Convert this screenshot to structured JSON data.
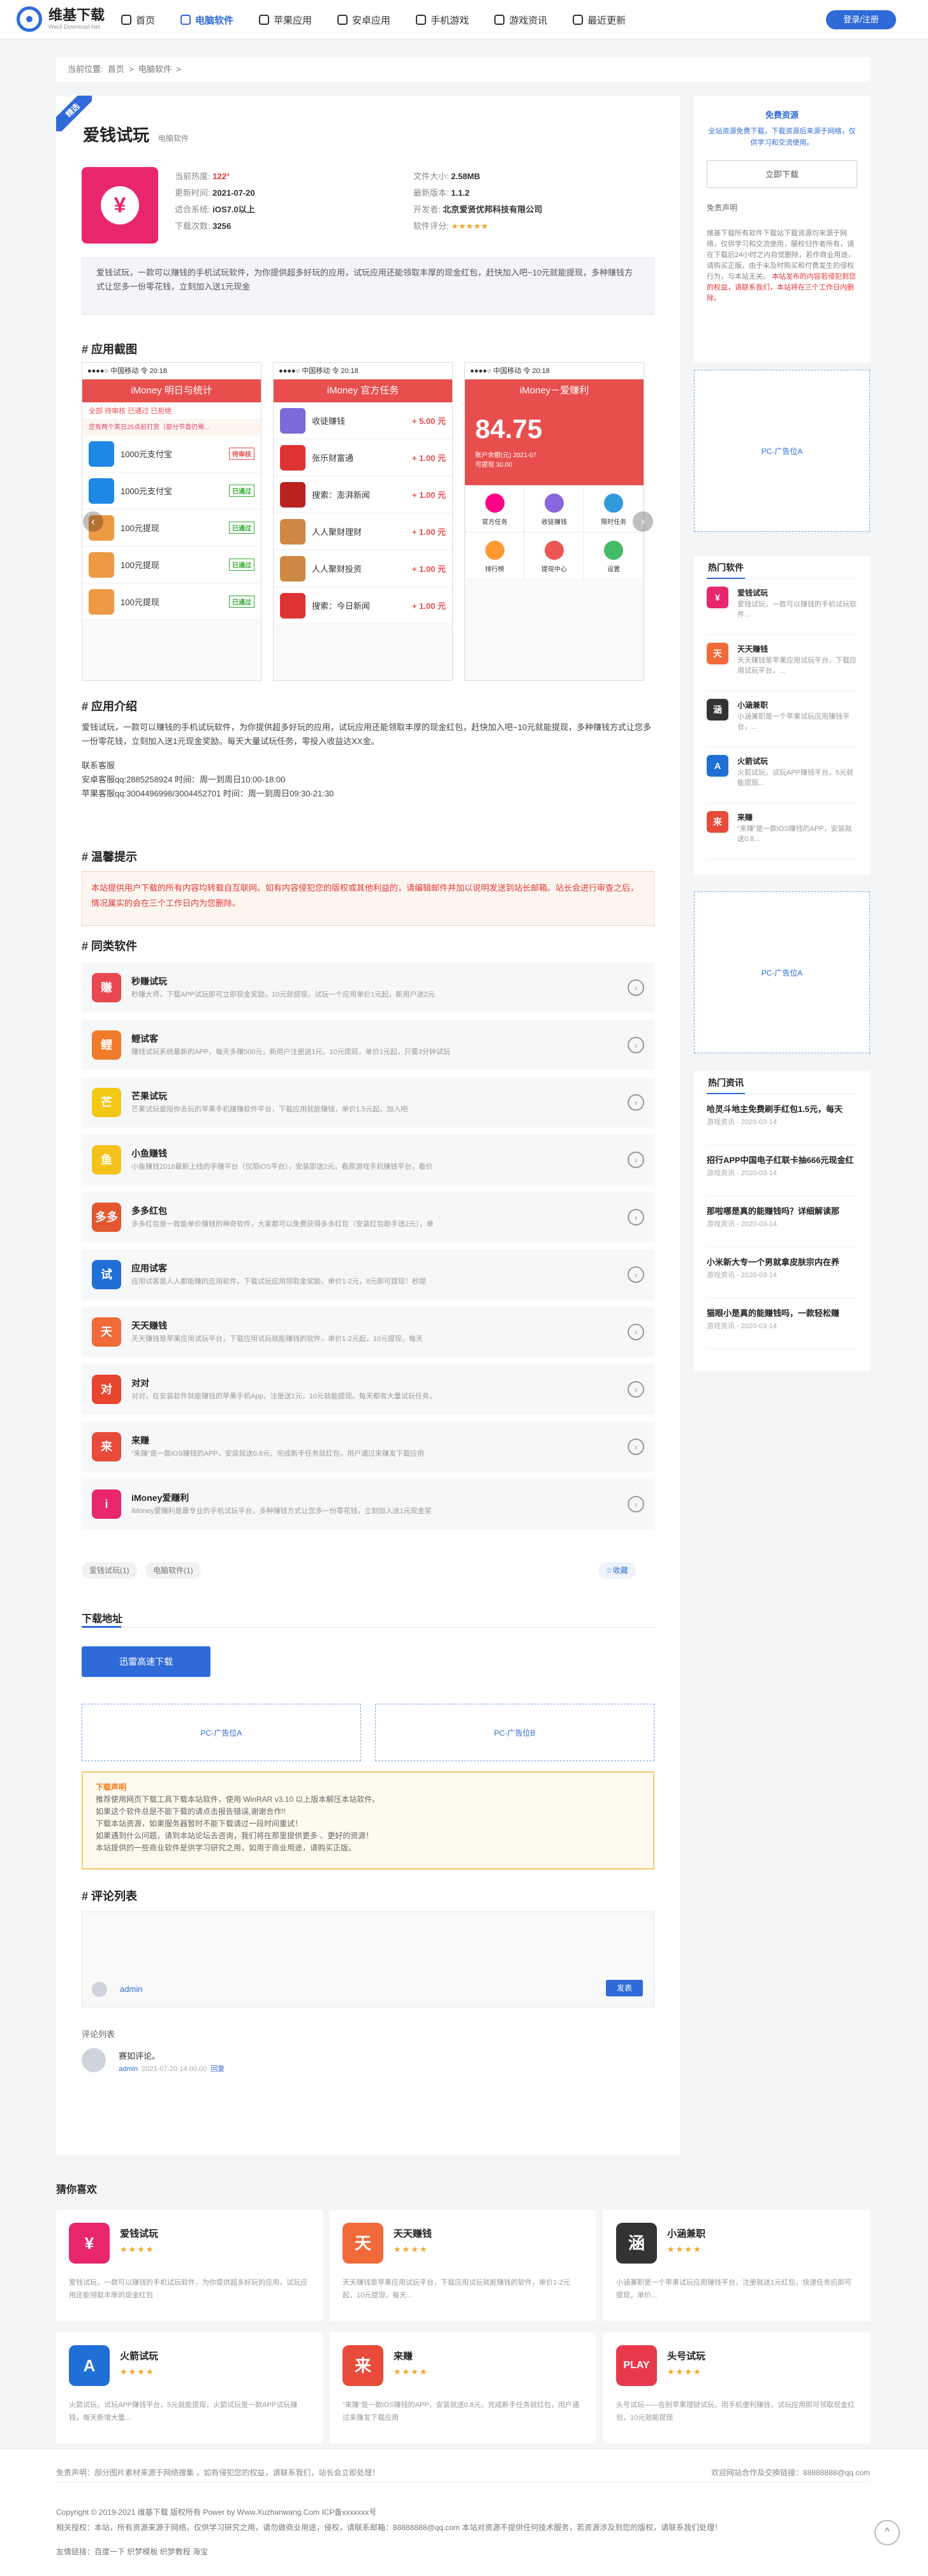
{
  "header": {
    "logo_title": "维基下载",
    "logo_sub": "WeiJi Download Net",
    "nav": [
      "首页",
      "电脑软件",
      "苹果应用",
      "安卓应用",
      "手机游戏",
      "游戏资讯",
      "最近更新"
    ],
    "login": "登录/注册"
  },
  "breadcrumb": {
    "label": "当前位置:",
    "home": "首页",
    "sep1": ">",
    "cat": "电脑软件",
    "sep2": ">"
  },
  "app": {
    "badge": "精选",
    "name": "爱钱试玩",
    "category": "电脑软件",
    "meta_left": [
      {
        "k": "当前热度:",
        "v": "122°"
      },
      {
        "k": "更新时间:",
        "v": "2021-07-20"
      },
      {
        "k": "适合系统:",
        "v": "iOS7.0以上"
      },
      {
        "k": "下载次数:",
        "v": "3256"
      }
    ],
    "meta_right": [
      {
        "k": "文件大小:",
        "v": "2.58MB"
      },
      {
        "k": "最新版本:",
        "v": "1.1.2"
      },
      {
        "k": "开发者:",
        "v": "北京爱贤优邦科技有限公司"
      },
      {
        "k": "软件评分:",
        "v": "★★★★★"
      }
    ],
    "description": "爱钱试玩，一款可以赚钱的手机试玩软件，为你提供超多好玩的应用，试玩应用还能领取丰厚的现金红包，赶快加入吧~10元就能提现，多种赚钱方式让您多一份零花钱，立刻加入送1元现金"
  },
  "screenshots": {
    "title": "应用截图",
    "shots": [
      {
        "status": "●●●●○ 中国移动 令   20:18",
        "header": "iMoney   明日与统计",
        "tabs": "全部  待审核  已通过  已拒绝",
        "note": "您有两个笑日25点前打赏（部分节首仍需...",
        "rows": [
          {
            "name": "1000元支付宝",
            "amt": "待审核"
          },
          {
            "name": "1000元支付宝",
            "amt": "已通过"
          },
          {
            "name": "100元提现",
            "amt": "已通过"
          },
          {
            "name": "100元提现",
            "amt": "已通过"
          },
          {
            "name": "100元提现",
            "amt": "已通过"
          }
        ]
      },
      {
        "status": "●●●●○ 中国移动 令   20:18",
        "header": "iMoney    官方任务",
        "rows": [
          {
            "name": "收徒赚钱",
            "amt": "+ 5.00 元"
          },
          {
            "name": "张乐财富通",
            "amt": "+ 1.00 元"
          },
          {
            "name": "搜索：澎湃新闻",
            "amt": "+ 1.00 元"
          },
          {
            "name": "人人聚财理财",
            "amt": "+ 1.00 元"
          },
          {
            "name": "人人聚财投资",
            "amt": "+ 1.00 元"
          },
          {
            "name": "搜索：今日新闻",
            "amt": "+ 1.00 元"
          }
        ]
      },
      {
        "status": "●●●●○ 中国移动 令   20:18",
        "header": "iMoney－爱赚利",
        "balance": "84.75",
        "sub1": "账户余额(元)   2021-07",
        "sub2": "可提现 30.00",
        "grid": [
          "官方任务",
          "收徒赚钱",
          "限时任务",
          "排行榜",
          "提现中心",
          "设置"
        ]
      }
    ]
  },
  "intro": {
    "title": "应用介绍",
    "p1": "爱钱试玩，一款可以赚钱的手机试玩软件，为你提供超多好玩的应用，试玩应用还能领取丰厚的现金红包，赶快加入吧~10元就能提现，多种赚钱方式让您多一份零花钱，立刻加入送1元现金奖励。每天大量试玩任务，零投入收益达XX金。",
    "contact_h": "联系客服",
    "c1": "安卓客服qq:2885258924 时间：周一到周日10:00-18:00",
    "c2": "苹果客服qq:3004496998/3004452701 时间：周一到周日09:30-21:30"
  },
  "warning": {
    "title": "温馨提示",
    "text": "本站提供用户下载的所有内容均转载自互联网。如有内容侵犯您的版权或其他利益的，请编辑邮件并加以说明发送到站长邮箱。站长会进行审查之后，情况属实的会在三个工作日内为您删除。"
  },
  "similar": {
    "title": "同类软件",
    "items": [
      {
        "name": "秒赚试玩",
        "desc": "秒赚大师，下载APP试玩即可立即现金奖励，10元就提现，试玩一个应用单价1元起，新用户送2元",
        "ic": "#e9474f",
        "t": "賺"
      },
      {
        "name": "鲤试客",
        "desc": "赚钱试玩系统最新的APP，每天多赚500元，新用户注册送1元，10元提现，单价1元起，只要3分钟试玩",
        "ic": "#f07b2b",
        "t": "鲤"
      },
      {
        "name": "芒果试玩",
        "desc": "芒果试玩是陪你去玩的苹果手机赚赚软件平台，下载应用就能赚钱，单价1.5元起，加入吧",
        "ic": "#f3c716",
        "t": "芒"
      },
      {
        "name": "小鱼赚钱",
        "desc": "小鱼赚钱2016最新上线的手赚平台（仅限iOS平台），安装即送2元，看原游戏手机赚钱平台，看价",
        "ic": "#f5c21c",
        "t": "鱼"
      },
      {
        "name": "多多红包",
        "desc": "多多红包是一款能单价赚钱的神奇软件，大家都可以免费获得多多红包（安装红包助手送2元），单",
        "ic": "#e4572e",
        "t": "多多"
      },
      {
        "name": "应用试客",
        "desc": "应用试客是人人都能赚的应用软件，下载试玩应用领取金奖励，单价1-2元，8元即可提现！秒提",
        "ic": "#1f6fd6",
        "t": "试"
      },
      {
        "name": "天天赚钱",
        "desc": "天天赚钱是苹果应用试玩平台，下载应用试玩就能赚钱的软件，单价1-2元起，10元提现，每天",
        "ic": "#f06a3a",
        "t": "天"
      },
      {
        "name": "对对",
        "desc": "对对，在安装软件就能赚钱的苹果手机App，注册送1元，10元就能提现。每天都有大量试玩任务，",
        "ic": "#e8452f",
        "t": "对"
      },
      {
        "name": "来赚",
        "desc": "“来赚”是一款iOS赚钱的APP，安装就送0.8元，完成新手任务就红包，用户通过来赚发下载应用",
        "ic": "#e84b3a",
        "t": "来"
      },
      {
        "name": "iMoney爱赚利",
        "desc": "iMoney爱赚利是最专业的手机试玩平台，多种赚钱方式让您多一份零花钱，立刻加入送1元现金奖",
        "ic": "#e8266e",
        "t": "i"
      }
    ]
  },
  "tags": [
    "爱钱试玩(1)",
    "电脑软件(1)"
  ],
  "favorite": "☆收藏",
  "download": {
    "title": "下载地址",
    "button": "迅雷高速下载"
  },
  "ads": {
    "a": "PC-广告位A",
    "b": "PC-广告位B",
    "side": "PC-广告位A"
  },
  "notice": {
    "title": "下载声明",
    "lines": [
      "推荐使用网页下载工具下载本站软件，使用 WinRAR v3.10 以上版本解压本站软件。",
      "如果这个软件总是不能下载的请点击报告错误,谢谢合作!!",
      "下载本站资源，如果服务器暂时不能下载请过一段时间重试！",
      "如果遇到什么问题，请到本站论坛去咨询，我们将在那里提供更多 、更好的资源！",
      "本站提供的一些商业软件是供学习研究之用，如用于商业用途，请购买正版。"
    ]
  },
  "comments": {
    "title": "评论列表",
    "user": "admin",
    "submit": "发表",
    "list_label": "评论列表",
    "first": "赛如评论。",
    "c_user": "admin",
    "c_time": "2021-07-20 14:00:00",
    "c_reply": "回复"
  },
  "side": {
    "free_title": "免费资源",
    "free_text": "全站资源免费下载，下载资源后来源于网络，仅供学习和交流使用。",
    "download_now": "立即下载",
    "disclaimer": "免责声明",
    "disclaimer_text": "维基下载所有软件下载站下载资源均来源于网络，仅供学习和交流使用，服权归作者所有，请在下载后24小时之内自觉删除，若作商业用途，请购买正版，由于未及时购买和付费发生的侵权行为，与本站无关。",
    "disclaimer_red": "本站发布的内容若侵犯到您的权益，请联系我们，本站将在三个工作日内删除。",
    "hot_title": "热门软件",
    "hot": [
      {
        "name": "爱钱试玩",
        "desc": "爱钱试玩，一款可以赚钱的手机试玩软件...",
        "ic": "#e8266e",
        "t": "¥"
      },
      {
        "name": "天天赚钱",
        "desc": "天天赚钱是苹果应用试玩平台，下载应用试玩平台，...",
        "ic": "#f06a3a",
        "t": "天"
      },
      {
        "name": "小涵兼职",
        "desc": "小涵兼职是一个苹果试玩应用赚钱平台，...",
        "ic": "#333",
        "t": "涵"
      },
      {
        "name": "火箭试玩",
        "desc": "火箭试玩，试玩APP赚钱平台，5元就能提现...",
        "ic": "#1f6fd6",
        "t": "A"
      },
      {
        "name": "来赚",
        "desc": "“来赚”是一款iOS赚钱的APP，安装就送0.8...",
        "ic": "#e84b3a",
        "t": "来"
      }
    ],
    "news_title": "热门资讯",
    "news": [
      {
        "t": "哈灵斗地主免费刷手红包1.5元，每天",
        "m": "游戏资讯 - 2020-03-14"
      },
      {
        "t": "招行APP中国电子红联卡抽666元现金红",
        "m": "游戏资讯 - 2020-03-14"
      },
      {
        "t": "那啦哪是真的能赚钱吗？详细解读那",
        "m": "游戏资讯 - 2020-03-14"
      },
      {
        "t": "小米新大专一个男就拿皮肤宗内在养",
        "m": "游戏资讯 - 2020-03-14"
      },
      {
        "t": "猫眼小是真的能赚钱吗，一款轻松赚",
        "m": "游戏资讯 - 2020-03-14"
      }
    ]
  },
  "guess": {
    "title": "猜你喜欢",
    "stars": "★★★★",
    "items": [
      {
        "name": "爱钱试玩",
        "desc": "爱钱试玩，一款可以赚钱的手机试玩软件，为你提供超多好玩的应用，试玩应用还能领取丰厚的现金红包",
        "ic": "#e8266e",
        "t": "¥"
      },
      {
        "name": "天天赚钱",
        "desc": "天天赚钱是苹果应用试玩平台，下载应用试玩就能赚钱的软件，单价1-2元起，10元提现，每天...",
        "ic": "#f06a3a",
        "t": "天"
      },
      {
        "name": "小涵兼职",
        "desc": "小涵兼职是一个苹果试玩应用赚钱平台，注册就送1元红包，快速任务后即可提现，单价...",
        "ic": "#333",
        "t": "涵"
      },
      {
        "name": "火箭试玩",
        "desc": "火箭试玩，试玩APP赚钱平台，5元就能提现，火箭试玩是一款APP试玩赚钱，每天新增大量...",
        "ic": "#1f6fd6",
        "t": "A"
      },
      {
        "name": "来赚",
        "desc": "“来赚”是一款iOS赚钱的APP，安装就送0.8元，完成新手任务就红包，用户通过来赚发下载应用",
        "ic": "#e84b3a",
        "t": "来"
      },
      {
        "name": "头号试玩",
        "desc": "头号试玩——告别苹果理财试玩，用手机便利赚钱，试玩应用即可领取现金红包，10元就能提现",
        "ic": "#e8394a",
        "t": "PLAY"
      }
    ]
  },
  "footer": {
    "disclaimer": "免责声明：部分图片素材来源于网络搜集 ，如有侵犯您的权益，请联系我们，站长会立即处理！",
    "email": "欢迎网站合作及交换链接：88888888@qq.com",
    "copyright": "Copyright © 2019-2021 维基下载 版权所有 Power by Www.Xuzhanwang.Com  ICP备xxxxxxx号",
    "links": "相关授权：本站，所有资源来源于网络，仅供学习研究之用，请勿做商业用途，侵权，请联系邮箱：88888888@qq.com 本站对资源不提供任何技术服务，若资源涉及到您的版权，请联系我们处理！",
    "friends": "友情链接：百度一下  织梦模板  织梦教程  海宝"
  }
}
